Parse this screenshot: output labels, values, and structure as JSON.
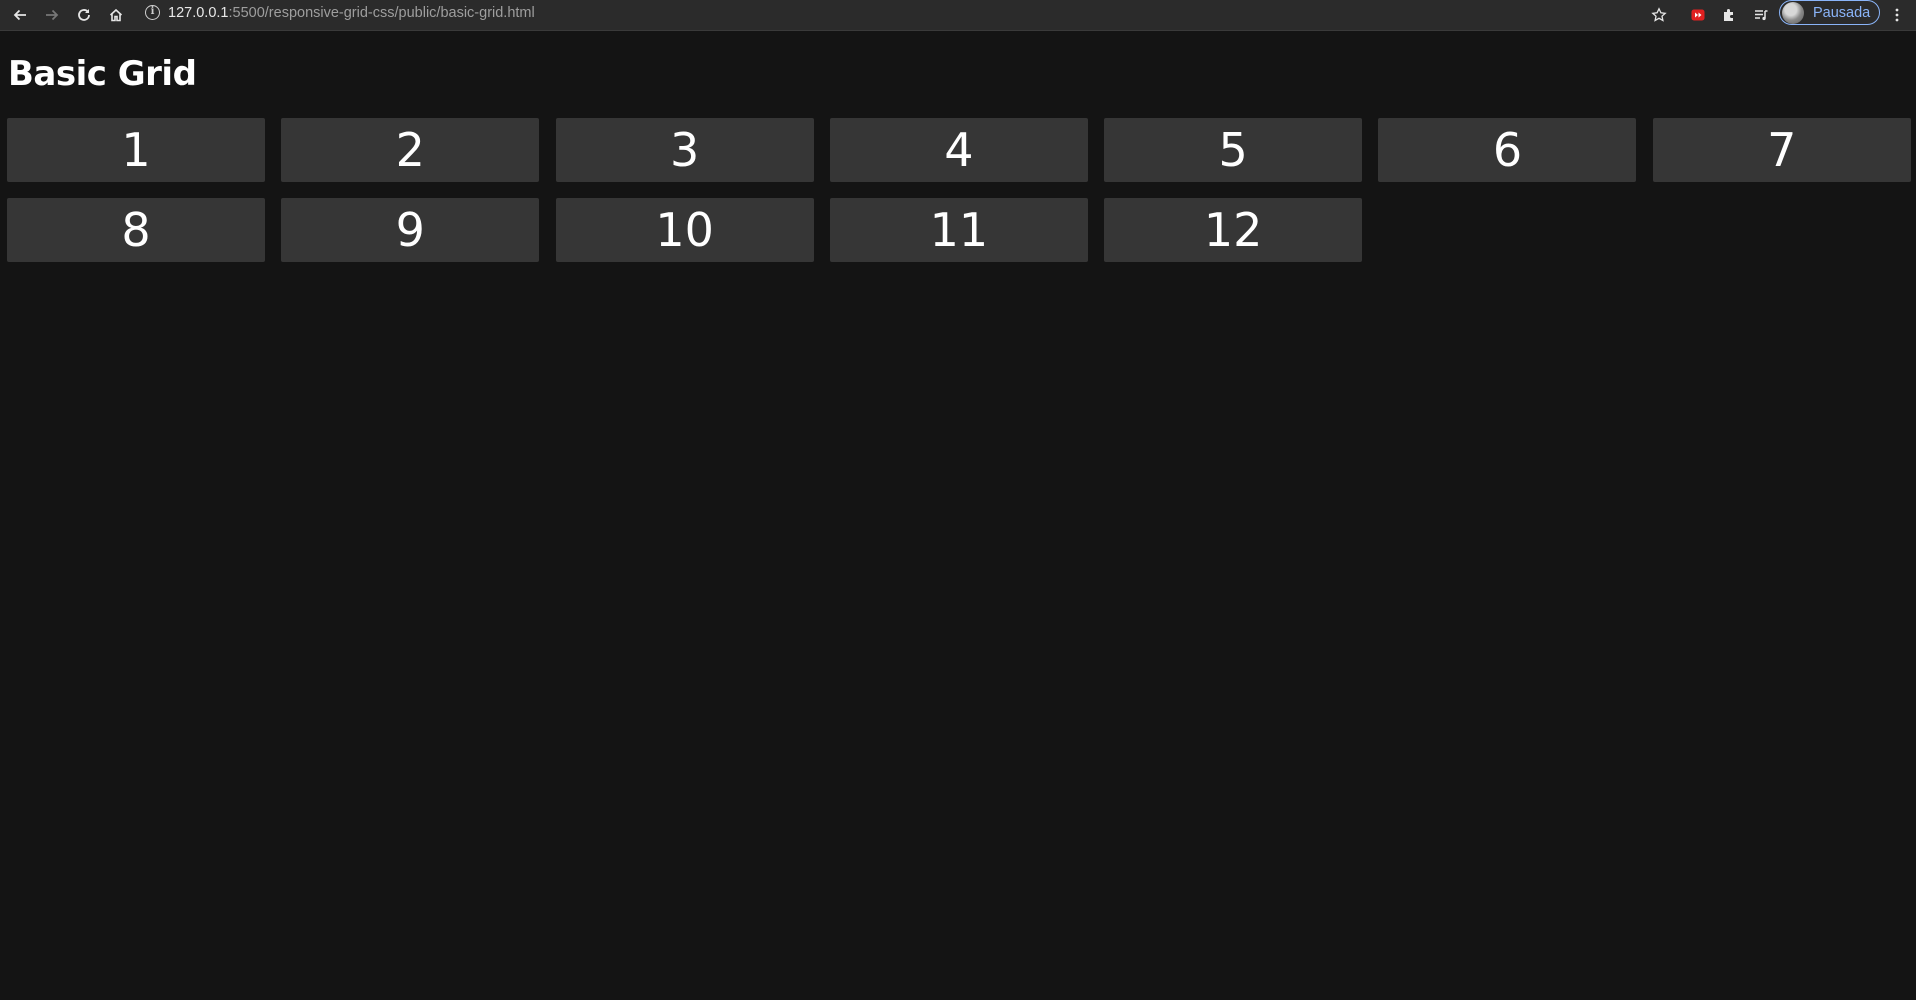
{
  "browser": {
    "url_host": "127.0.0.1",
    "url_rest": ":5500/responsive-grid-css/public/basic-grid.html",
    "profile_name": "Pausada",
    "icons": [
      "back-icon",
      "forward-icon",
      "reload-icon",
      "home-icon",
      "info-icon",
      "star-icon",
      "youtube-extension-icon",
      "extensions-icon",
      "reading-list-icon",
      "menu-icon"
    ]
  },
  "page": {
    "title": "Basic Grid",
    "items": [
      "1",
      "2",
      "3",
      "4",
      "5",
      "6",
      "7",
      "8",
      "9",
      "10",
      "11",
      "12"
    ]
  },
  "colors": {
    "background": "#141414",
    "cell": "#363636",
    "toolbar": "#2b2b2b",
    "accent": "#8ab4f8"
  }
}
